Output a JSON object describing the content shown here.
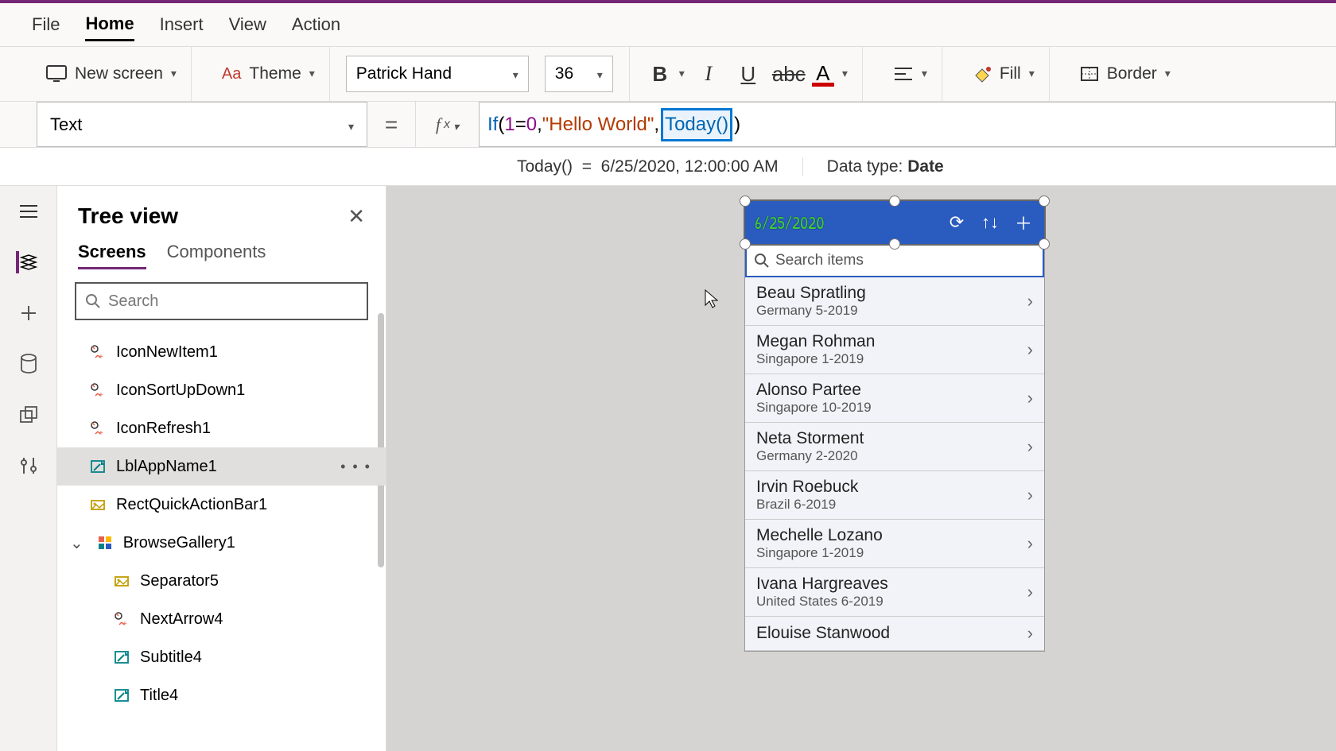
{
  "menu": {
    "file": "File",
    "home": "Home",
    "insert": "Insert",
    "view": "View",
    "action": "Action"
  },
  "ribbon": {
    "new_screen": "New screen",
    "theme": "Theme",
    "font": "Patrick Hand",
    "size": "36",
    "fill": "Fill",
    "border": "Border"
  },
  "property_selector": "Text",
  "formula": {
    "prefix": "If",
    "lparen": "(",
    "cond_l": "1",
    "cond_op": "=",
    "cond_r": "0",
    "comma1": ", ",
    "str": "\"Hello World\"",
    "comma2": ", ",
    "fn": "Today()",
    "rparen": ")"
  },
  "formula_result": {
    "expr": "Today()",
    "eq": "=",
    "val": "6/25/2020, 12:00:00 AM"
  },
  "datatype_label": "Data type: ",
  "datatype_value": "Date",
  "tree": {
    "title": "Tree view",
    "tab_screens": "Screens",
    "tab_components": "Components",
    "search_placeholder": "Search",
    "items": [
      {
        "name": "IconNewItem1",
        "type": "icon"
      },
      {
        "name": "IconSortUpDown1",
        "type": "icon"
      },
      {
        "name": "IconRefresh1",
        "type": "icon"
      },
      {
        "name": "LblAppName1",
        "type": "label",
        "selected": true
      },
      {
        "name": "RectQuickActionBar1",
        "type": "rect"
      },
      {
        "name": "BrowseGallery1",
        "type": "gallery",
        "expandable": true
      },
      {
        "name": "Separator5",
        "type": "rect",
        "indent": true
      },
      {
        "name": "NextArrow4",
        "type": "icon",
        "indent": true
      },
      {
        "name": "Subtitle4",
        "type": "label",
        "indent": true
      },
      {
        "name": "Title4",
        "type": "label",
        "indent": true
      }
    ]
  },
  "app": {
    "header_title": "6/25/2020",
    "search_placeholder": "Search items",
    "records": [
      {
        "name": "Beau Spratling",
        "sub": "Germany 5-2019"
      },
      {
        "name": "Megan Rohman",
        "sub": "Singapore 1-2019"
      },
      {
        "name": "Alonso Partee",
        "sub": "Singapore 10-2019"
      },
      {
        "name": "Neta Storment",
        "sub": "Germany 2-2020"
      },
      {
        "name": "Irvin Roebuck",
        "sub": "Brazil 6-2019"
      },
      {
        "name": "Mechelle Lozano",
        "sub": "Singapore 1-2019"
      },
      {
        "name": "Ivana Hargreaves",
        "sub": "United States 6-2019"
      },
      {
        "name": "Elouise Stanwood",
        "sub": ""
      }
    ]
  }
}
